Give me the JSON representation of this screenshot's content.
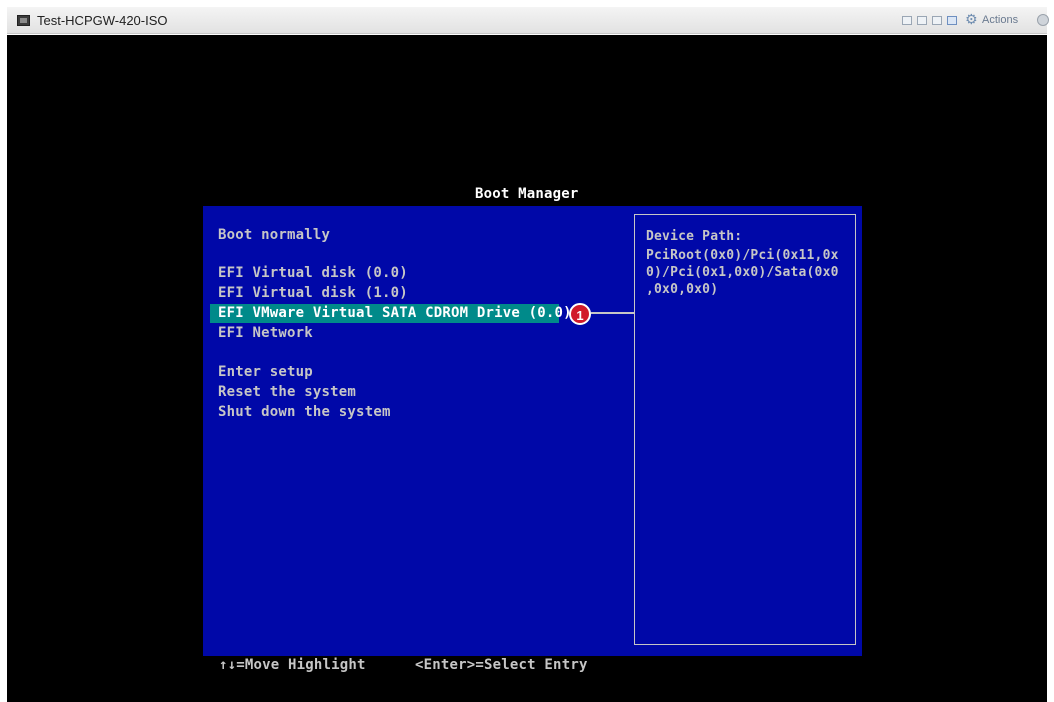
{
  "window": {
    "title": "Test-HCPGW-420-ISO",
    "actions_label": "Actions",
    "toolbar_icons": [
      "console-icon",
      "snapshot-icon",
      "window-icon",
      "network-icon"
    ]
  },
  "boot_manager": {
    "title": "Boot Manager",
    "items": [
      "Boot normally",
      "EFI Virtual disk (0.0)",
      "EFI Virtual disk (1.0)",
      "EFI VMware Virtual SATA CDROM Drive (0.0)",
      "EFI Network",
      "Enter setup",
      "Reset the system",
      "Shut down the system"
    ],
    "selected_index": 3,
    "callout_number": "1",
    "device_path_lines": [
      "Device Path:",
      "PciRoot(0x0)/Pci(0x11,0x",
      "0)/Pci(0x1,0x0)/Sata(0x0",
      ",0x0,0x0)"
    ],
    "footer": {
      "move_hint": "↑↓=Move Highlight",
      "enter_hint": "<Enter>=Select Entry"
    }
  },
  "colors": {
    "panel_bg": "#0008a8",
    "highlight_bg": "#008a8a",
    "text": "#c6c6c6",
    "callout": "#d11a2a"
  }
}
